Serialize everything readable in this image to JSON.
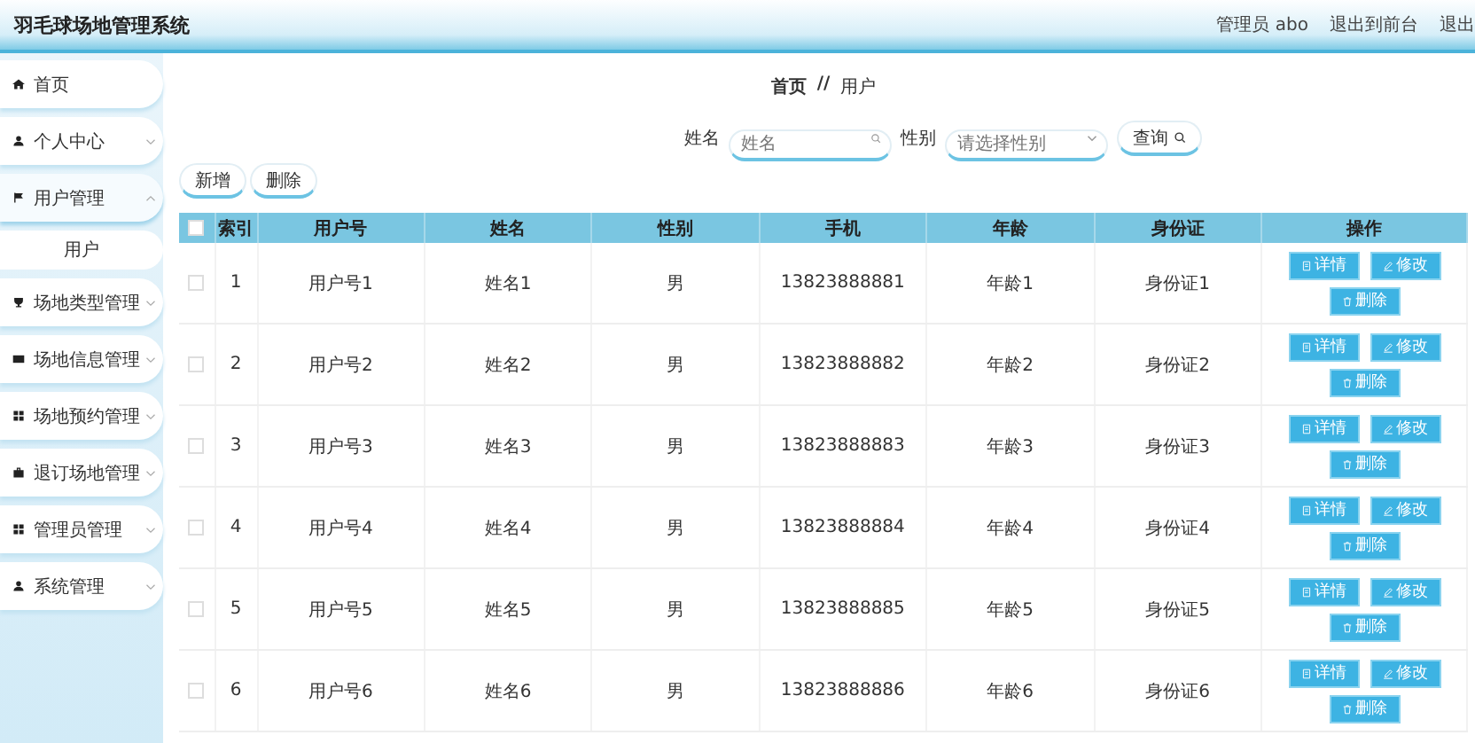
{
  "header": {
    "title": "羽毛球场地管理系统",
    "user": "管理员 abo",
    "links": [
      "退出到前台",
      "退出"
    ]
  },
  "sidebar": {
    "items": [
      {
        "label": "首页",
        "kind": "link"
      },
      {
        "label": "个人中心",
        "kind": "menu",
        "expanded": false
      },
      {
        "label": "用户管理",
        "kind": "menu",
        "expanded": true,
        "children": [
          {
            "label": "用户"
          }
        ]
      },
      {
        "label": "场地类型管理",
        "kind": "menu",
        "expanded": false
      },
      {
        "label": "场地信息管理",
        "kind": "menu",
        "expanded": false
      },
      {
        "label": "场地预约管理",
        "kind": "menu",
        "expanded": false
      },
      {
        "label": "退订场地管理",
        "kind": "menu",
        "expanded": false
      },
      {
        "label": "管理员管理",
        "kind": "menu",
        "expanded": false
      },
      {
        "label": "系统管理",
        "kind": "menu",
        "expanded": false
      }
    ]
  },
  "breadcrumb": {
    "items": [
      "首页",
      "用户"
    ],
    "separator": "//"
  },
  "search": {
    "fields": [
      {
        "label": "姓名",
        "placeholder": "姓名",
        "kind": "input"
      },
      {
        "label": "性别",
        "placeholder": "请选择性别",
        "kind": "select"
      }
    ],
    "button": "查询"
  },
  "actions": [
    "新增",
    "删除"
  ],
  "table": {
    "header_checked": false,
    "columns": [
      "索引",
      "用户号",
      "姓名",
      "性别",
      "手机",
      "年龄",
      "身份证",
      "操作"
    ],
    "rows": [
      {
        "checked": false,
        "cells": [
          "1",
          "用户号1",
          "姓名1",
          "男",
          "13823888881",
          "年龄1",
          "身份证1"
        ],
        "actions": [
          "详情",
          "修改",
          "删除"
        ]
      },
      {
        "checked": false,
        "cells": [
          "2",
          "用户号2",
          "姓名2",
          "男",
          "13823888882",
          "年龄2",
          "身份证2"
        ],
        "actions": [
          "详情",
          "修改",
          "删除"
        ]
      },
      {
        "checked": false,
        "cells": [
          "3",
          "用户号3",
          "姓名3",
          "男",
          "13823888883",
          "年龄3",
          "身份证3"
        ],
        "actions": [
          "详情",
          "修改",
          "删除"
        ]
      },
      {
        "checked": false,
        "cells": [
          "4",
          "用户号4",
          "姓名4",
          "男",
          "13823888884",
          "年龄4",
          "身份证4"
        ],
        "actions": [
          "详情",
          "修改",
          "删除"
        ]
      },
      {
        "checked": false,
        "cells": [
          "5",
          "用户号5",
          "姓名5",
          "男",
          "13823888885",
          "年龄5",
          "身份证5"
        ],
        "actions": [
          "详情",
          "修改",
          "删除"
        ]
      },
      {
        "checked": false,
        "cells": [
          "6",
          "用户号6",
          "姓名6",
          "男",
          "13823888886",
          "年龄6",
          "身份证6"
        ],
        "actions": [
          "详情",
          "修改",
          "删除"
        ]
      }
    ]
  }
}
